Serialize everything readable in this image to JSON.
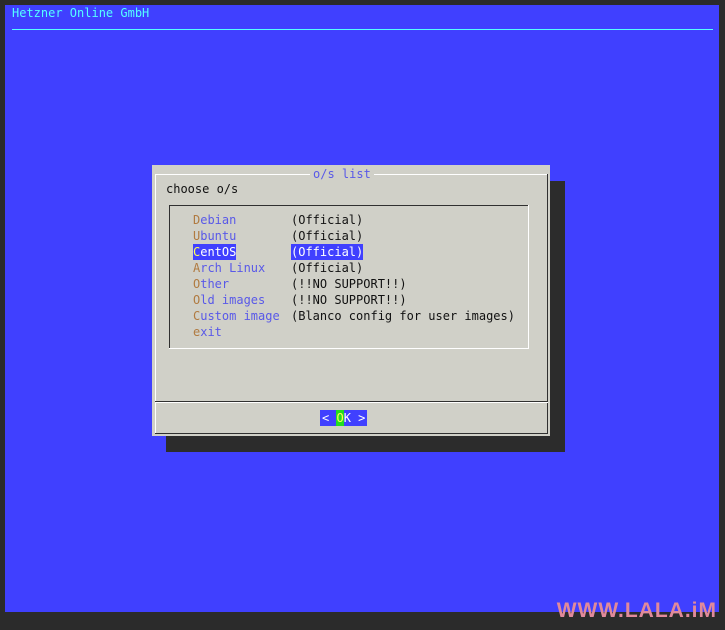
{
  "backtitle": "Hetzner Online GmbH",
  "dialog": {
    "title": "o/s list",
    "prompt": "choose o/s",
    "items": [
      {
        "hot": "D",
        "rest": "ebian",
        "desc": "(Official)"
      },
      {
        "hot": "U",
        "rest": "buntu",
        "desc": "(Official)"
      },
      {
        "hot": "C",
        "rest": "entOS",
        "desc": "(Official)"
      },
      {
        "hot": "A",
        "rest": "rch Linux",
        "desc": "(Official)"
      },
      {
        "hot": "O",
        "rest": "ther",
        "desc": "(!!NO SUPPORT!!)"
      },
      {
        "hot": "O",
        "rest": "ld images",
        "desc": "(!!NO SUPPORT!!)"
      },
      {
        "hot": "C",
        "rest": "ustom image",
        "desc": "(Blanco config for user images)"
      },
      {
        "hot": "e",
        "rest": "xit",
        "desc": ""
      }
    ],
    "selected_index": 2,
    "ok_button": {
      "left": "< ",
      "hot": "O",
      "rest": "K",
      "right": " >"
    }
  },
  "watermark": "WWW.LALA.iM",
  "colors": {
    "screen_bg": "#4040ff",
    "dialog_bg": "#d0d0c8",
    "accent_cyan": "#55ffff",
    "highlight_bg": "#4040ff",
    "hotkey": "#b07a40"
  }
}
